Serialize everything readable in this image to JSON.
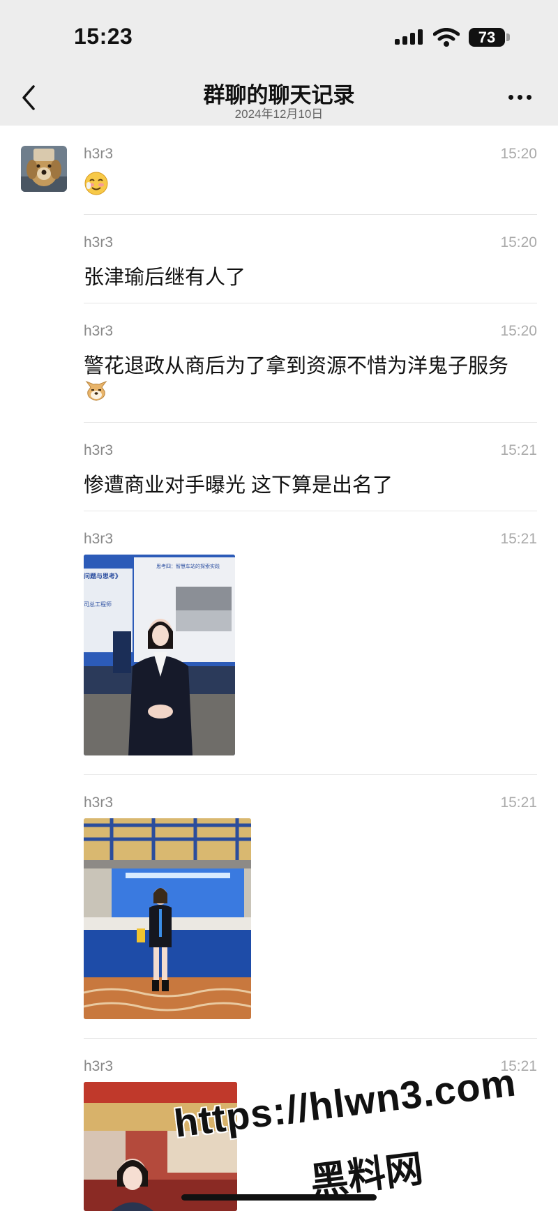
{
  "status_bar": {
    "time": "15:23",
    "battery": "73"
  },
  "header": {
    "title": "群聊的聊天记录",
    "date": "2024年12月10日"
  },
  "messages": [
    {
      "sender": "h3r3",
      "time": "15:20",
      "text": ""
    },
    {
      "sender": "h3r3",
      "time": "15:20",
      "text": "张津瑜后继有人了"
    },
    {
      "sender": "h3r3",
      "time": "15:20",
      "text": "警花退政从商后为了拿到资源不惜为洋鬼子服务"
    },
    {
      "sender": "h3r3",
      "time": "15:21",
      "text": "惨遭商业对手曝光 这下算是出名了"
    },
    {
      "sender": "h3r3",
      "time": "15:21",
      "text": ""
    },
    {
      "sender": "h3r3",
      "time": "15:21",
      "text": ""
    },
    {
      "sender": "h3r3",
      "time": "15:21",
      "text": ""
    }
  ],
  "photo_captions": {
    "photo1_slide_title": "思考四：智慧车站的探索实践",
    "photo1_side_text_1": "问题与思考》",
    "photo1_side_text_2": "司总工程师"
  },
  "watermark": {
    "url": "https://hlwn3.com",
    "name": "黑料网"
  },
  "icons": {
    "back": "chevron-left-icon",
    "more": "more-dots-icon",
    "emoji1": "smiling-face-emoji",
    "emoji2": "doge-emoji"
  }
}
